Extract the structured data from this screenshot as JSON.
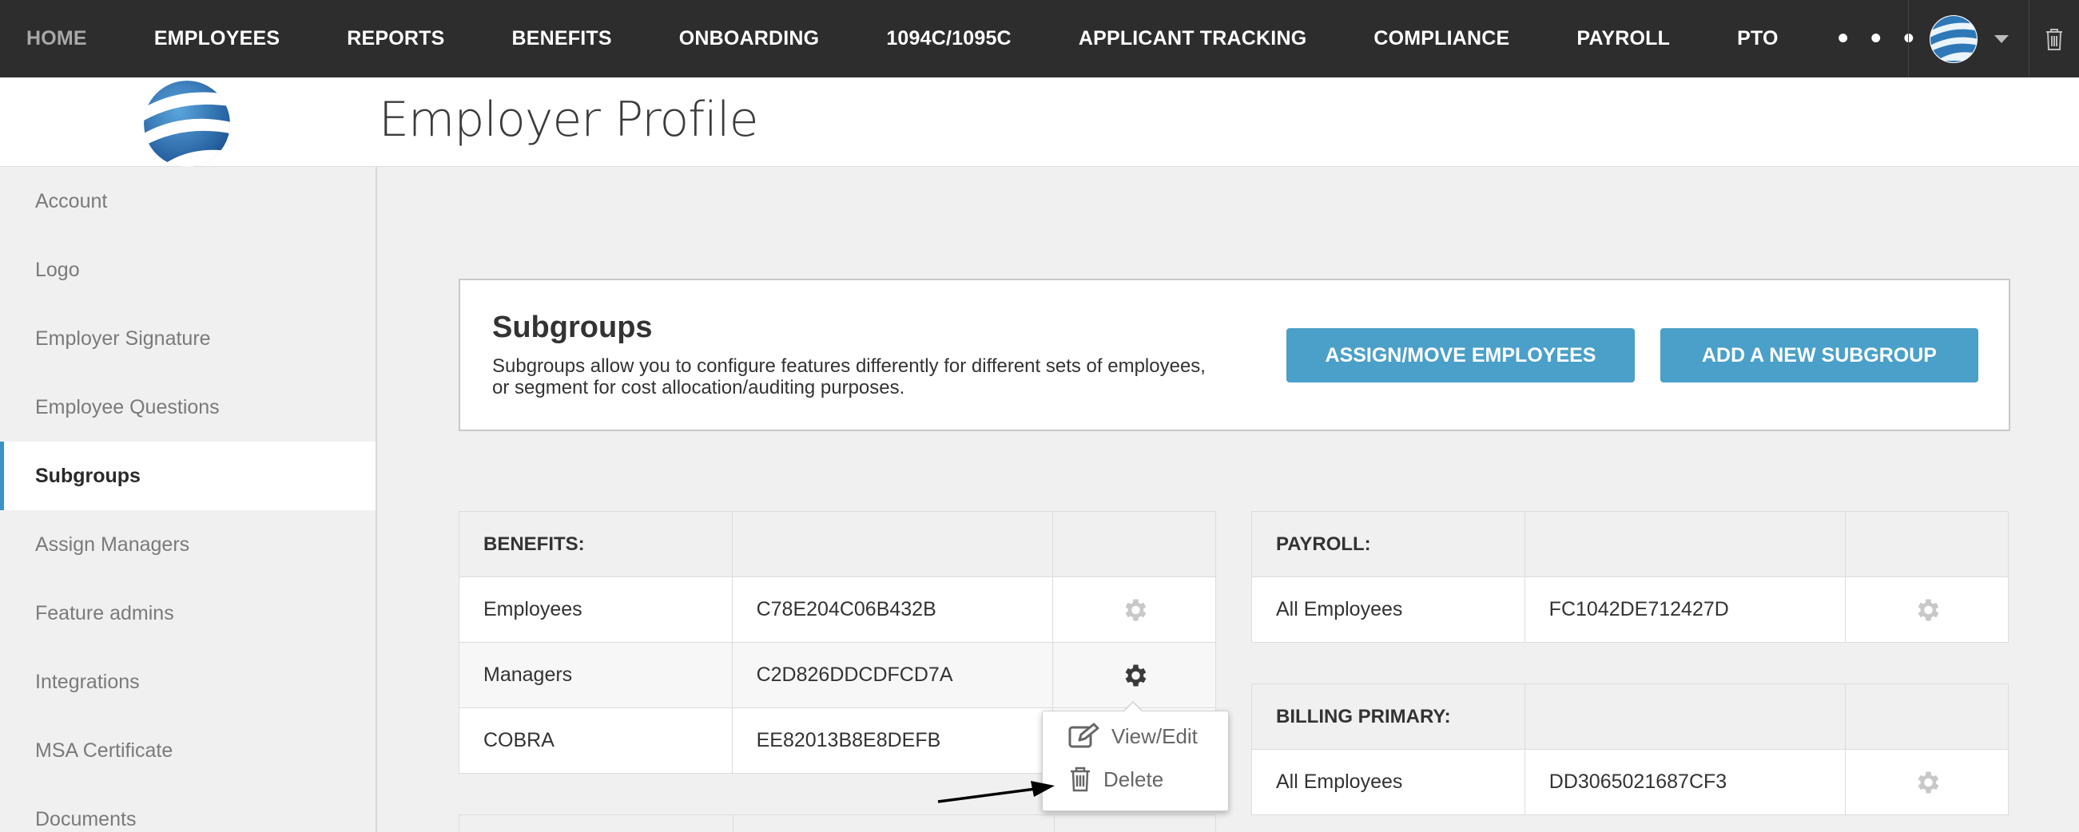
{
  "topnav": {
    "items": [
      "HOME",
      "EMPLOYEES",
      "REPORTS",
      "BENEFITS",
      "ONBOARDING",
      "1094C/1095C",
      "APPLICANT TRACKING",
      "COMPLIANCE",
      "PAYROLL",
      "PTO"
    ],
    "more": "• • •",
    "icons": [
      "globe-logo-icon",
      "chevron-down-icon",
      "trash-icon"
    ]
  },
  "header": {
    "title": "Employer Profile",
    "logo_icon": "globe-logo-icon"
  },
  "sidebar": {
    "items": [
      {
        "label": "Account",
        "active": false
      },
      {
        "label": "Logo",
        "active": false
      },
      {
        "label": "Employer Signature",
        "active": false
      },
      {
        "label": "Employee Questions",
        "active": false
      },
      {
        "label": "Subgroups",
        "active": true
      },
      {
        "label": "Assign Managers",
        "active": false
      },
      {
        "label": "Feature admins",
        "active": false
      },
      {
        "label": "Integrations",
        "active": false
      },
      {
        "label": "MSA Certificate",
        "active": false
      },
      {
        "label": "Documents",
        "active": false
      }
    ]
  },
  "subgroups": {
    "title": "Subgroups",
    "description": "Subgroups allow you to configure features differently for different sets of employees, or segment for cost allocation/auditing purposes.",
    "assign_button": "ASSIGN/MOVE EMPLOYEES",
    "add_button": "ADD A NEW SUBGROUP"
  },
  "benefits_table": {
    "header": "BENEFITS:",
    "rows": [
      {
        "name": "Employees",
        "code": "C78E204C06B432B"
      },
      {
        "name": "Managers",
        "code": "C2D826DDCDFCD7A"
      },
      {
        "name": "COBRA",
        "code": "EE82013B8E8DEFB"
      }
    ]
  },
  "payroll_table": {
    "header": "PAYROLL:",
    "rows": [
      {
        "name": "All Employees",
        "code": "FC1042DE712427D"
      }
    ]
  },
  "billing_table": {
    "header": "BILLING PRIMARY:",
    "rows": [
      {
        "name": "All Employees",
        "code": "DD3065021687CF3"
      }
    ]
  },
  "context_menu": {
    "view_edit": "View/Edit",
    "delete": "Delete"
  },
  "colors": {
    "nav_bg": "#2d2d2d",
    "accent": "#4aa0c8",
    "active_marker": "#3b92c4"
  }
}
